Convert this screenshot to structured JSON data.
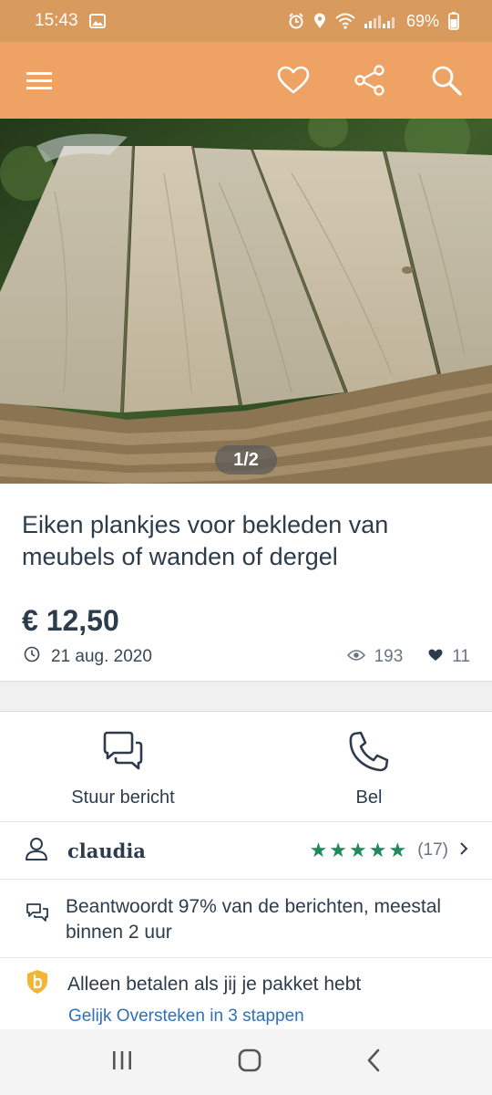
{
  "status_bar": {
    "time": "15:43",
    "battery": "69%",
    "icons": [
      "image-icon",
      "alarm-icon",
      "location-icon",
      "wifi-icon",
      "signal-icon",
      "battery-icon"
    ]
  },
  "app_bar": {
    "icons": [
      "menu-icon",
      "heart-icon",
      "share-icon",
      "search-icon"
    ],
    "background": "#eea364"
  },
  "photo": {
    "counter": "1/2"
  },
  "listing": {
    "title": "Eiken plankjes voor bekleden van meubels of wanden of dergel",
    "price": "€ 12,50",
    "date": "21 aug. 2020",
    "views": "193",
    "favorites": "11"
  },
  "actions": {
    "message_label": "Stuur bericht",
    "call_label": "Bel"
  },
  "seller": {
    "name": "claudia",
    "stars": "★★★★★",
    "rating_count": "(17)",
    "star_color": "#1f8a5b"
  },
  "response": {
    "text": "Beantwoordt 97% van de berichten, meestal binnen 2 uur"
  },
  "buyer_protection": {
    "text": "Alleen betalen als jij je pakket hebt",
    "link": "Gelijk Oversteken in 3 stappen",
    "link_color": "#2f70b8"
  },
  "nav_bar": {
    "icons": [
      "recent-apps-icon",
      "home-icon",
      "back-icon"
    ]
  }
}
